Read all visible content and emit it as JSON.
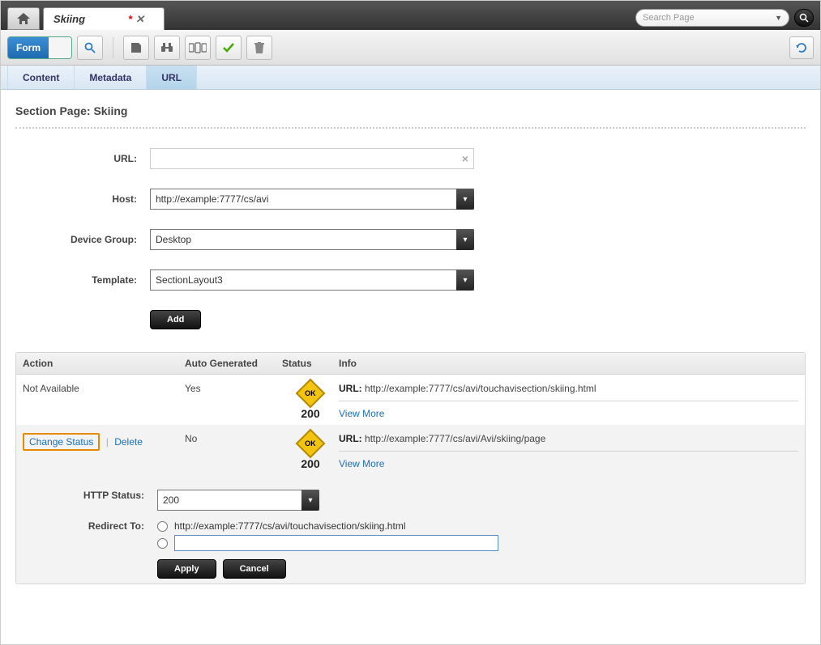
{
  "header": {
    "tab_title": "Skiing",
    "dirty_marker": "*",
    "search_placeholder": "Search Page"
  },
  "toolbar": {
    "form_label": "Form"
  },
  "tabs": {
    "content": "Content",
    "metadata": "Metadata",
    "url": "URL"
  },
  "page": {
    "title": "Section Page: Skiing"
  },
  "form": {
    "url_label": "URL:",
    "host_label": "Host:",
    "host_value": "http://example:7777/cs/avi",
    "device_group_label": "Device Group:",
    "device_group_value": "Desktop",
    "template_label": "Template:",
    "template_value": "SectionLayout3",
    "add_label": "Add"
  },
  "table": {
    "headers": {
      "action": "Action",
      "auto": "Auto Generated",
      "status": "Status",
      "info": "Info"
    },
    "rows": [
      {
        "action_text": "Not Available",
        "auto": "Yes",
        "ok_text": "OK",
        "status_code": "200",
        "info_label": "URL:",
        "info_url": "http://example:7777/cs/avi/touchavisection/skiing.html",
        "view_more": "View More"
      },
      {
        "change_status": "Change Status",
        "delete": "Delete",
        "auto": "No",
        "ok_text": "OK",
        "status_code": "200",
        "info_label": "URL:",
        "info_url": "http://example:7777/cs/avi/Avi/skiing/page",
        "view_more": "View More"
      }
    ]
  },
  "expand": {
    "http_status_label": "HTTP Status:",
    "http_status_value": "200",
    "redirect_label": "Redirect To:",
    "redirect_option1": "http://example:7777/cs/avi/touchavisection/skiing.html",
    "apply": "Apply",
    "cancel": "Cancel"
  }
}
